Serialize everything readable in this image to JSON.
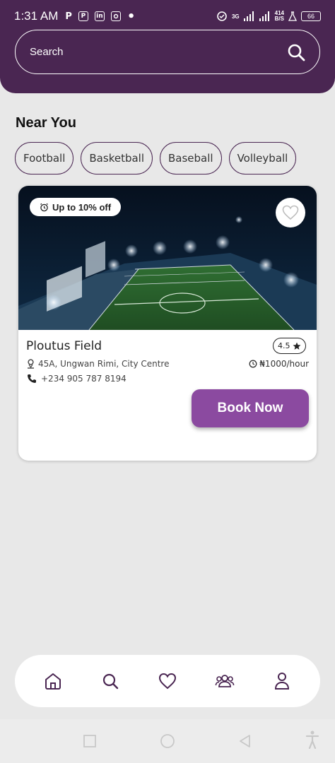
{
  "status_bar": {
    "time": "1:31 AM",
    "apps": [
      "P",
      "P",
      "in",
      "ig"
    ],
    "network": "3G",
    "speed_top": "414",
    "speed_bottom": "B/S",
    "battery": "66"
  },
  "search": {
    "placeholder": "Search"
  },
  "section": {
    "title": "Near You"
  },
  "chips": [
    "Football",
    "Basketball",
    "Baseball",
    "Volleyball"
  ],
  "card": {
    "discount": "Up to 10% off",
    "name": "Ploutus Field",
    "rating": "4.5",
    "address": "45A, Ungwan Rimi, City Centre",
    "price": "₦1000/hour",
    "phone": "+234 905 787 8194",
    "book_label": "Book Now"
  },
  "bottom_nav": {
    "items": [
      "home-icon",
      "search-icon",
      "heart-icon",
      "users-icon",
      "profile-icon"
    ],
    "active_color": "#4a2652"
  },
  "colors": {
    "header": "#4a2652",
    "accent": "#8b4aa0",
    "background": "#e8e8e8"
  }
}
